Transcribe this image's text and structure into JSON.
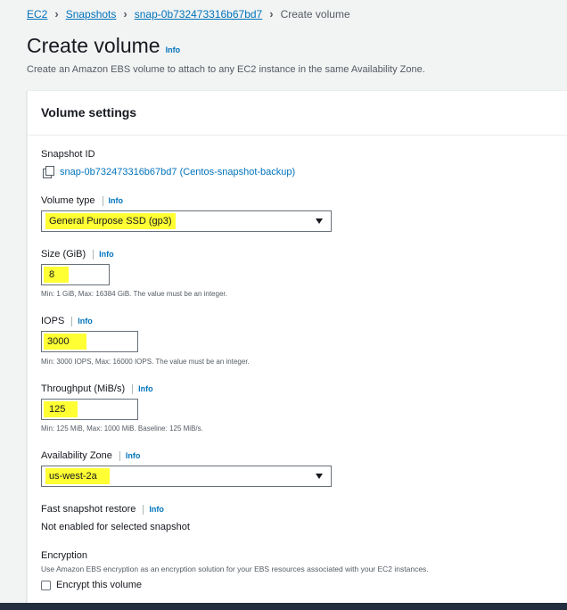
{
  "breadcrumb": {
    "items": [
      "EC2",
      "Snapshots",
      "snap-0b732473316b67bd7"
    ],
    "current": "Create volume"
  },
  "header": {
    "title": "Create volume",
    "info": "Info",
    "description": "Create an Amazon EBS volume to attach to any EC2 instance in the same Availability Zone."
  },
  "panel": {
    "title": "Volume settings",
    "snapshot_id": {
      "label": "Snapshot ID",
      "value": "snap-0b732473316b67bd7 (Centos-snapshot-backup)"
    },
    "volume_type": {
      "label": "Volume type",
      "info": "Info",
      "selected": "General Purpose SSD (gp3)"
    },
    "size": {
      "label": "Size (GiB)",
      "info": "Info",
      "value": "8",
      "hint": "Min: 1 GiB, Max: 16384 GiB. The value must be an integer."
    },
    "iops": {
      "label": "IOPS",
      "info": "Info",
      "value": "3000",
      "hint": "Min: 3000 IOPS, Max: 16000 IOPS. The value must be an integer."
    },
    "throughput": {
      "label": "Throughput (MiB/s)",
      "info": "Info",
      "value": "125",
      "hint": "Min: 125 MiB, Max: 1000 MiB. Baseline: 125 MiB/s."
    },
    "availability_zone": {
      "label": "Availability Zone",
      "info": "Info",
      "selected": "us-west-2a"
    },
    "fast_snapshot_restore": {
      "label": "Fast snapshot restore",
      "info": "Info",
      "value": "Not enabled for selected snapshot"
    },
    "encryption": {
      "label": "Encryption",
      "description": "Use Amazon EBS encryption as an encryption solution for your EBS resources associated with your EC2 instances.",
      "checkbox_label": "Encrypt this volume",
      "checked": false
    }
  },
  "colors": {
    "link": "#0073bb",
    "highlight": "#ffff33",
    "background": "#f2f3f3",
    "footer": "#232f3e"
  },
  "icons": [
    "chevron-right-icon",
    "copy-icon",
    "caret-down-icon"
  ]
}
